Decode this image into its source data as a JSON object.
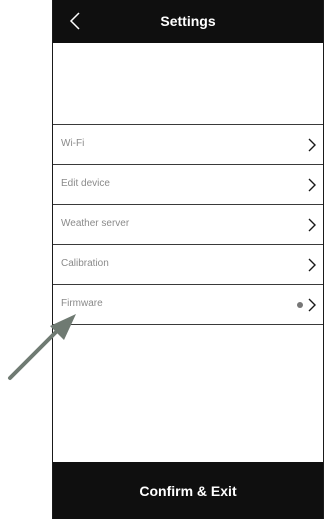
{
  "header": {
    "title": "Settings",
    "back_icon": "chevron-left-icon"
  },
  "menu": {
    "items": [
      {
        "label": "Wi-Fi",
        "icon": "chevron-right-icon"
      },
      {
        "label": "Edit device",
        "icon": "chevron-right-icon"
      },
      {
        "label": "Weather server",
        "icon": "chevron-right-icon"
      },
      {
        "label": "Calibration",
        "icon": "chevron-right-icon"
      },
      {
        "label": "Firmware",
        "icon": "chevron-right-icon",
        "has_indicator_dot": true
      }
    ]
  },
  "footer": {
    "confirm_label": "Confirm & Exit"
  },
  "colors": {
    "bar_background": "#0f0f0f",
    "bar_text": "#ffffff",
    "row_label": "#8a8a8a",
    "divider": "#3a3a3a",
    "indicator_dot": "#777777",
    "annotation_arrow": "#6f7a72"
  }
}
